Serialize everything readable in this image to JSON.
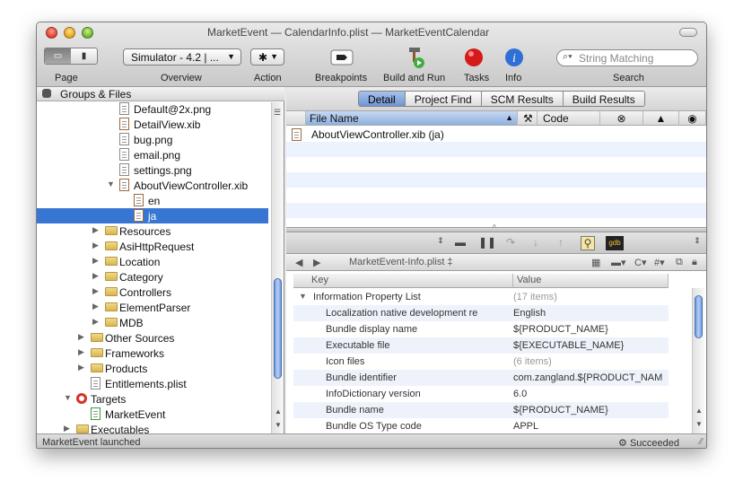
{
  "window": {
    "title": "MarketEvent — CalendarInfo.plist — MarketEventCalendar",
    "status_left": "MarketEvent launched",
    "status_right": "Succeeded"
  },
  "toolbar": {
    "page_label": "Page",
    "scheme_value": "Simulator - 4.2 | ...",
    "overview_label": "Overview",
    "action_label": "Action",
    "breakpoints_label": "Breakpoints",
    "build_run_label": "Build and Run",
    "tasks_label": "Tasks",
    "info_label": "Info",
    "search_placeholder": "String Matching",
    "search_label": "Search"
  },
  "sidebar": {
    "header": "Groups & Files",
    "items": [
      {
        "label": "Default@2x.png",
        "kind": "file"
      },
      {
        "label": "DetailView.xib",
        "kind": "xib"
      },
      {
        "label": "bug.png",
        "kind": "file"
      },
      {
        "label": "email.png",
        "kind": "file"
      },
      {
        "label": "settings.png",
        "kind": "file"
      },
      {
        "label": "AboutViewController.xib",
        "kind": "xib"
      },
      {
        "label": "en",
        "kind": "xib"
      },
      {
        "label": "ja",
        "kind": "xib",
        "selected": true
      },
      {
        "label": "Resources",
        "kind": "folder"
      },
      {
        "label": "AsiHttpRequest",
        "kind": "folder"
      },
      {
        "label": "Location",
        "kind": "folder"
      },
      {
        "label": "Category",
        "kind": "folder"
      },
      {
        "label": "Controllers",
        "kind": "folder"
      },
      {
        "label": "ElementParser",
        "kind": "folder"
      },
      {
        "label": "MDB",
        "kind": "folder"
      },
      {
        "label": "Other Sources",
        "kind": "folder"
      },
      {
        "label": "Frameworks",
        "kind": "folder"
      },
      {
        "label": "Products",
        "kind": "folder"
      },
      {
        "label": "Entitlements.plist",
        "kind": "file"
      },
      {
        "label": "Targets",
        "kind": "target"
      },
      {
        "label": "MarketEvent",
        "kind": "app"
      },
      {
        "label": "Executables",
        "kind": "folder"
      }
    ]
  },
  "tabs": [
    "Detail",
    "Project Find",
    "SCM Results",
    "Build Results"
  ],
  "results": {
    "columns": [
      "File Name",
      "Code"
    ],
    "rows": [
      {
        "file": "AboutViewController.xib (ja)"
      }
    ]
  },
  "editor": {
    "nav_path": "MarketEvent-Info.plist ‡"
  },
  "plist": {
    "columns": [
      "Key",
      "Value"
    ],
    "rows": [
      {
        "key": "Information Property List",
        "value": "(17 items)"
      },
      {
        "key": "Localization native development re",
        "value": "English"
      },
      {
        "key": "Bundle display name",
        "value": "${PRODUCT_NAME}"
      },
      {
        "key": "Executable file",
        "value": "${EXECUTABLE_NAME}"
      },
      {
        "key": "Icon files",
        "value": "(6 items)"
      },
      {
        "key": "Bundle identifier",
        "value": "com.zangland.${PRODUCT_NAM"
      },
      {
        "key": "InfoDictionary version",
        "value": "6.0"
      },
      {
        "key": "Bundle name",
        "value": "${PRODUCT_NAME}"
      },
      {
        "key": "Bundle OS Type code",
        "value": "APPL"
      }
    ]
  }
}
